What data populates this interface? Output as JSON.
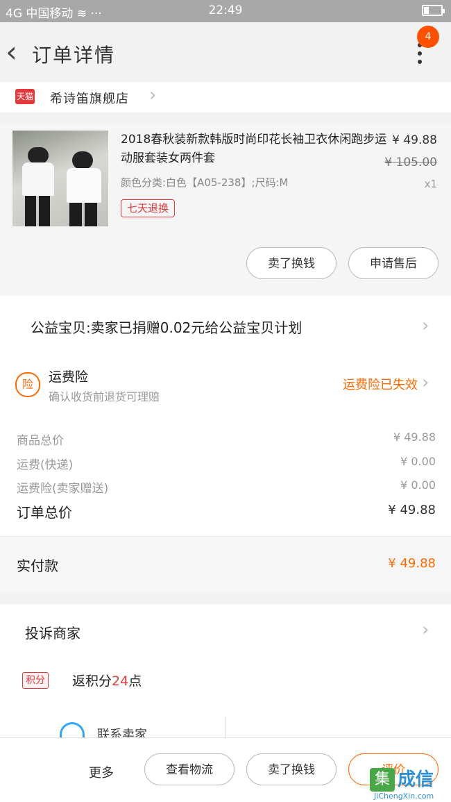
{
  "status_bar": {
    "left": "4G 中国移动 ≋ ···",
    "time": "22:49"
  },
  "header": {
    "title": "订单详情",
    "badge_count": "4"
  },
  "store": {
    "logo_text": "天猫",
    "name": "希诗笛旗舰店"
  },
  "product": {
    "title": "2018春秋装新款韩版时尚印花长袖卫衣休闲跑步运动服套装女两件套",
    "spec": "颜色分类:白色【A05-238】;尺码:M",
    "price_current": "¥ 49.88",
    "price_original": "¥ 105.00",
    "quantity": "x1",
    "return_tag": "七天退换",
    "actions": [
      "卖了换钱",
      "申请售后"
    ]
  },
  "charity": {
    "text": "公益宝贝:卖家已捐赠0.02元给公益宝贝计划"
  },
  "insurance": {
    "icon_text": "险",
    "title": "运费险",
    "subtitle": "确认收货前退货可理赔",
    "status": "运费险已失效"
  },
  "summary": {
    "items": [
      {
        "label": "商品总价",
        "value": "¥ 49.88"
      },
      {
        "label": "运费(快递)",
        "value": "¥ 0.00"
      },
      {
        "label": "运费险(卖家赠送)",
        "value": "¥ 0.00"
      }
    ],
    "total_label": "订单总价",
    "total_value": "¥ 49.88"
  },
  "paid": {
    "label": "实付款",
    "value": "¥ 49.88"
  },
  "complaint": {
    "text": "投诉商家"
  },
  "points": {
    "badge": "积分",
    "prefix": "返积分",
    "number": "24",
    "suffix": "点"
  },
  "contact": {
    "text": "联系卖家"
  },
  "action_bar": {
    "more": "更多",
    "logistics": "查看物流",
    "sell": "卖了换钱",
    "review": "评价"
  },
  "watermark": {
    "logo": "集",
    "text": "成信",
    "url": "JiChengXin.com"
  },
  "colors": {
    "accent_orange": "#ff6a00",
    "tmall_red": "#e4393c",
    "badge": "#ff5000"
  }
}
